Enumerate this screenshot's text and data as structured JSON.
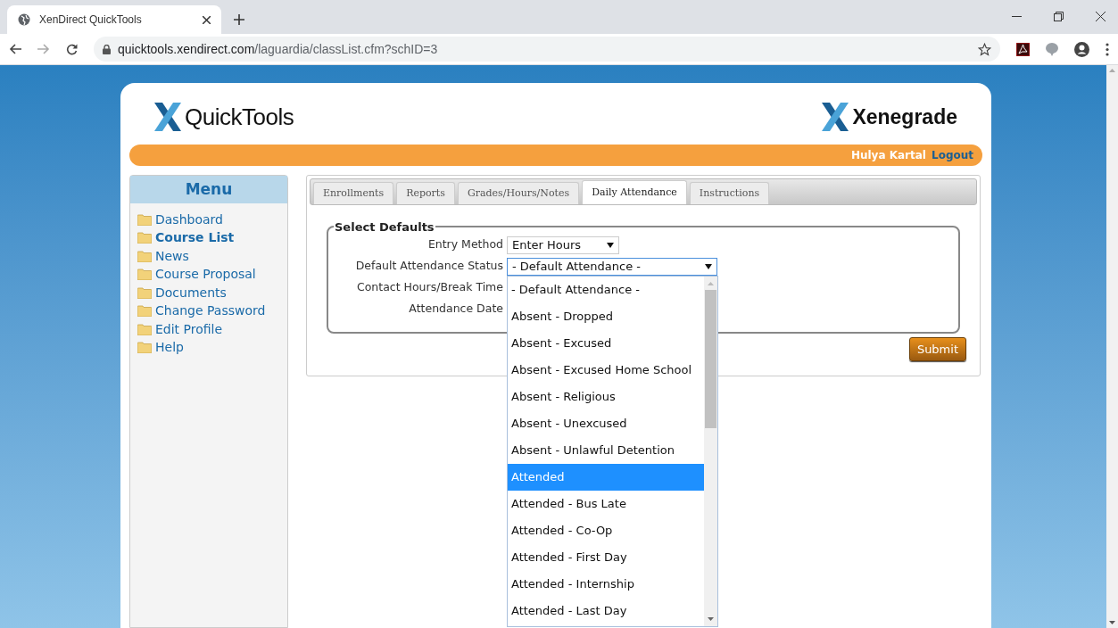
{
  "browser": {
    "tab_title": "XenDirect QuickTools",
    "url_domain": "quicktools.xendirect.com",
    "url_path": "/laguardia/classList.cfm?schID=3"
  },
  "header": {
    "app_name": "QuickTools",
    "brand": "Xenegrade"
  },
  "user_bar": {
    "user_name": "Hulya Kartal",
    "logout": "Logout"
  },
  "menu": {
    "title": "Menu",
    "items": [
      {
        "label": "Dashboard",
        "selected": false
      },
      {
        "label": "Course List",
        "selected": true
      },
      {
        "label": "News",
        "selected": false
      },
      {
        "label": "Course Proposal",
        "selected": false
      },
      {
        "label": "Documents",
        "selected": false
      },
      {
        "label": "Change Password",
        "selected": false
      },
      {
        "label": "Edit Profile",
        "selected": false
      },
      {
        "label": "Help",
        "selected": false
      }
    ]
  },
  "tabs": [
    {
      "label": "Enrollments",
      "selected": false
    },
    {
      "label": "Reports",
      "selected": false
    },
    {
      "label": "Grades/Hours/Notes",
      "selected": false
    },
    {
      "label": "Daily Attendance",
      "selected": true
    },
    {
      "label": "Instructions",
      "selected": false
    }
  ],
  "defaults": {
    "legend": "Select Defaults",
    "fields": [
      {
        "label": "Entry Method",
        "kind": "select",
        "value": "Enter Hours"
      },
      {
        "label": "Default Attendance Status",
        "kind": "select",
        "value": "- Default Attendance -",
        "open": true
      },
      {
        "label": "Contact Hours/Break Time",
        "kind": "blank"
      },
      {
        "label": "Attendance Date",
        "kind": "blank"
      }
    ]
  },
  "submit": "Submit",
  "dropdown_options": [
    {
      "label": "- Default Attendance -",
      "selected": false
    },
    {
      "label": "Absent - Dropped",
      "selected": false
    },
    {
      "label": "Absent - Excused",
      "selected": false
    },
    {
      "label": "Absent - Excused Home School",
      "selected": false
    },
    {
      "label": "Absent - Religious",
      "selected": false
    },
    {
      "label": "Absent - Unexcused",
      "selected": false
    },
    {
      "label": "Absent - Unlawful Detention",
      "selected": false
    },
    {
      "label": "Attended",
      "selected": true
    },
    {
      "label": "Attended - Bus Late",
      "selected": false
    },
    {
      "label": "Attended - Co-Op",
      "selected": false
    },
    {
      "label": "Attended - First Day",
      "selected": false
    },
    {
      "label": "Attended - Internship",
      "selected": false
    },
    {
      "label": "Attended - Last Day",
      "selected": false
    }
  ]
}
